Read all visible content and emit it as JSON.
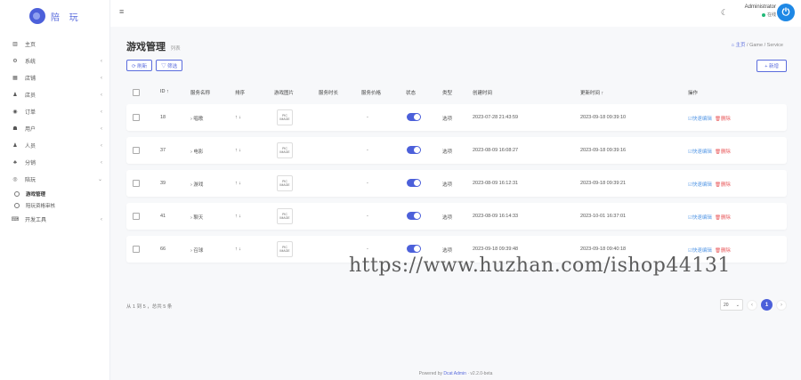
{
  "brand": {
    "name": "陪 玩"
  },
  "sidebar": {
    "items": [
      {
        "icon": "▥",
        "label": "主页",
        "arrow": ""
      },
      {
        "icon": "⚙",
        "label": "系统",
        "arrow": "‹"
      },
      {
        "icon": "▦",
        "label": "店铺",
        "arrow": "‹"
      },
      {
        "icon": "♟",
        "label": "店员",
        "arrow": "‹"
      },
      {
        "icon": "◉",
        "label": "订单",
        "arrow": "‹"
      },
      {
        "icon": "☗",
        "label": "用户",
        "arrow": "‹"
      },
      {
        "icon": "♟",
        "label": "人员",
        "arrow": "‹"
      },
      {
        "icon": "♣",
        "label": "分销",
        "arrow": "‹"
      },
      {
        "icon": "◎",
        "label": "陪玩",
        "arrow": "⌄"
      }
    ],
    "sub_items": [
      {
        "label": "游戏管理"
      },
      {
        "label": "陪玩资格审核"
      }
    ],
    "tools": {
      "icon": "⌨",
      "label": "开发工具",
      "arrow": "‹"
    }
  },
  "topbar": {
    "user_name": "Administrator",
    "user_status": "在线"
  },
  "page": {
    "title": "游戏管理",
    "subtitle": "列表",
    "breadcrumb": {
      "home": "主页",
      "sep1": "/",
      "level2": "Game",
      "sep2": "/",
      "level3": "Service"
    }
  },
  "toolbar": {
    "refresh": "⟳ 刷新",
    "filter": "▽ 筛选",
    "new": "+ 新增"
  },
  "table": {
    "headers": {
      "id": "ID ↑",
      "name": "服务名称",
      "order": "排序",
      "image": "游戏图片",
      "duration": "服务时长",
      "price": "服务价格",
      "status": "状态",
      "type": "类型",
      "created": "创建时间",
      "updated": "更新时间 ↑",
      "actions": "操作"
    },
    "rows": [
      {
        "id": "18",
        "name": "› 唱歌",
        "order": "↑ ↓",
        "image": "PIC IMAGE",
        "duration": "",
        "price": "-",
        "type": "选项",
        "created": "2023-07-28 21:43:59",
        "updated": "2023-09-18 09:39:10",
        "edit": "☑快速编辑",
        "del": "🗑删除"
      },
      {
        "id": "37",
        "name": "› 电影",
        "order": "↑ ↓",
        "image": "PIC IMAGE",
        "duration": "",
        "price": "-",
        "type": "选项",
        "created": "2023-08-09 16:08:27",
        "updated": "2023-09-18 09:39:16",
        "edit": "☑快速编辑",
        "del": "🗑删除"
      },
      {
        "id": "39",
        "name": "› 游戏",
        "order": "↑ ↓",
        "image": "PIC IMAGE",
        "duration": "",
        "price": "-",
        "type": "选项",
        "created": "2023-08-09 16:12:31",
        "updated": "2023-09-18 09:39:21",
        "edit": "☑快速编辑",
        "del": "🗑删除"
      },
      {
        "id": "41",
        "name": "› 聊天",
        "order": "↑ ↓",
        "image": "PIC IMAGE",
        "duration": "",
        "price": "-",
        "type": "选项",
        "created": "2023-08-09 16:14:33",
        "updated": "2023-10-01 16:37:01",
        "edit": "☑快速编辑",
        "del": "🗑删除"
      },
      {
        "id": "66",
        "name": "› 召球",
        "order": "↑ ↓",
        "image": "PIC IMAGE",
        "duration": "",
        "price": "-",
        "type": "选项",
        "created": "2023-09-18 09:39:48",
        "updated": "2023-09-18 09:40:18",
        "edit": "☑快速编辑",
        "del": "🗑删除"
      }
    ]
  },
  "pagination": {
    "info": "从 1 到 5 ，总共 5 条",
    "per_page": "20",
    "current": "1",
    "prev": "‹",
    "next": "›"
  },
  "watermark": "https://www.huzhan.com/ishop44131",
  "footer": {
    "prefix": "Powered by ",
    "link": "Dcat Admin",
    "version": " · v2.2.0-beta"
  },
  "colors": {
    "primary": "#4c60da",
    "success": "#21b978",
    "danger": "#e8585a",
    "power": "#1e88e5"
  }
}
